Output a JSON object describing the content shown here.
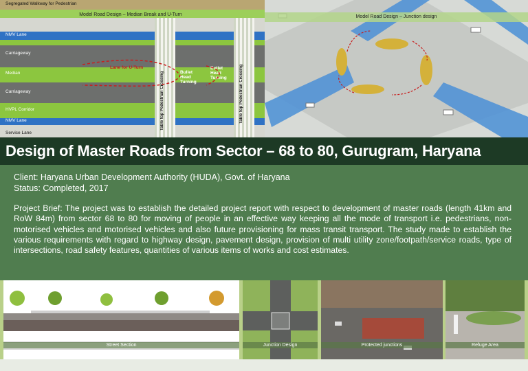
{
  "top_left": {
    "caption": "Model Road Design – Median Break and U-Turn",
    "labels": {
      "walkway": "Segregated Walkway for Pedestrian",
      "nmv_lane_top": "NMV Lane",
      "carriageway_top": "Carriageway",
      "median": "Median",
      "lane_for_uturn": "Lane for U-Turn",
      "carriageway_bottom": "Carriageway",
      "hvpl_corridor": "HVPL Corridor",
      "nmv_lane_bottom": "NMV Lane",
      "service_lane": "Service Lane",
      "crossing_left": "Table top Pedestrian Crossing",
      "crossing_right": "Table top Pedestrian Crossing",
      "bullet_head_left": "Bullet Head Turning",
      "bullet_head_right": "Bullet Head Turning"
    }
  },
  "top_right": {
    "caption": "Model Road Design – Junction design"
  },
  "title": "Design of Master Roads from Sector – 68 to 80, Gurugram, Haryana",
  "client": "Client: Haryana Urban Development Authority (HUDA), Govt. of Haryana",
  "status": "Status: Completed, 2017",
  "brief": "Project Brief: The project was to establish the detailed project report with respect to development of master roads (length 41km and RoW 84m) from sector 68 to 80 for moving of people in an effective way keeping all the mode of transport i.e. pedestrians, non-motorised vehicles and motorised vehicles and also future provisioning for mass transit transport. The study made to establish the various requirements with regard to highway design, pavement design, provision of multi utility zone/footpath/service roads, type of intersections, road safety features, quantities of various items of works and cost estimates.",
  "thumbnails": [
    {
      "caption": "Street Section"
    },
    {
      "caption": "Junction Design"
    },
    {
      "caption": "Protected junctions"
    },
    {
      "caption": "Refuge Area"
    }
  ],
  "colors": {
    "title_bar": "#1d3a25",
    "overlay_green": "#3c6e3c",
    "strip_green": "#b9d089",
    "median_green": "#8cc63f",
    "nmv_blue": "#2f72c4",
    "road_gray": "#6d6f6d"
  }
}
